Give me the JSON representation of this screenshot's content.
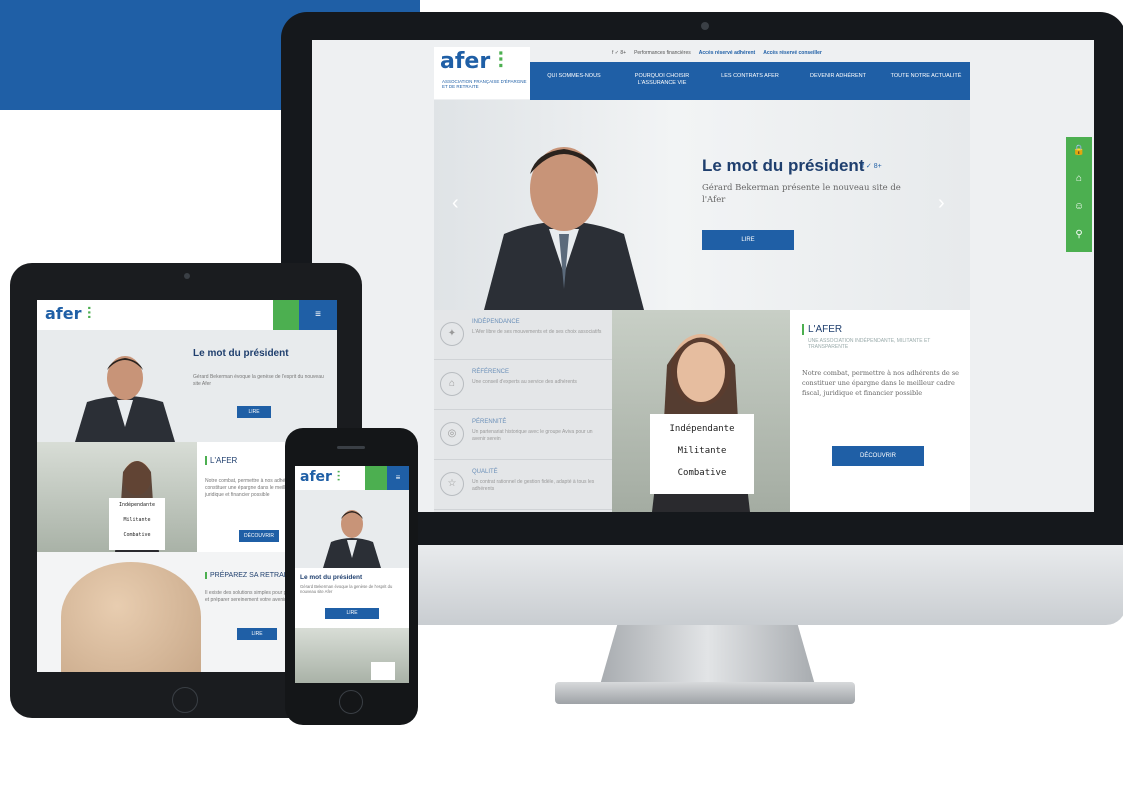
{
  "colors": {
    "brand_blue": "#1f5fa6",
    "brand_green": "#4caf50",
    "navy": "#1f3f6e"
  },
  "desktop": {
    "logo": {
      "word": "afer",
      "tagline": "ASSOCIATION FRANÇAISE D'ÉPARGNE ET DE RETRAITE"
    },
    "utility_bar": {
      "social_icons": "f  ✓  8+",
      "items": [
        "Performances financières",
        "Accès réservé adhérent",
        "Accès réservé conseiller"
      ]
    },
    "nav": [
      "QUI SOMMES-NOUS",
      "POURQUOI CHOISIR L'ASSURANCE VIE",
      "LES CONTRATS AFER",
      "DEVENIR ADHÉRENT",
      "TOUTE NOTRE ACTUALITÉ"
    ],
    "hero": {
      "title": "Le mot du président",
      "social": "f ✓ 8+",
      "text": "Gérard Bekerman présente le nouveau site de l'Afer",
      "button": "LIRE"
    },
    "features": [
      {
        "icon": "puzzle-icon",
        "title": "INDÉPENDANCE",
        "text": "L'Afer libre de ses mouvements et de ses choix associatifs"
      },
      {
        "icon": "building-icon",
        "title": "RÉFÉRENCE",
        "text": "Une conseil d'experts au service des adhérents"
      },
      {
        "icon": "shield-icon",
        "title": "PÉRENNITÉ",
        "text": "Un partenariat historique avec le groupe Aviva pour un avenir serein"
      },
      {
        "icon": "star-icon",
        "title": "QUALITÉ",
        "text": "Un contrat rationnel de gestion fidèle, adapté à tous les adhérents"
      }
    ],
    "sign_lines": [
      "Indépendante",
      "Militante",
      "Combative"
    ],
    "afer_box": {
      "title": "L'AFER",
      "subtitle": "UNE ASSOCIATION INDÉPENDANTE, MILITANTE ET TRANSPARENTE",
      "text": "Notre combat, permettre à nos adhérents de se constituer une épargne dans le meilleur cadre fiscal, juridique et financier possible",
      "button": "DÉCOUVRIR"
    },
    "side_tab": [
      "lock-icon",
      "bank-icon",
      "user-icon",
      "search-icon"
    ]
  },
  "tablet": {
    "hero_title": "Le mot du président",
    "hero_text": "Gérard Bekerman évoque la genèse de l'esprit du nouveau site Afer",
    "hero_button": "LIRE",
    "sign_lines": [
      "Indépendante",
      "Militante",
      "Combative"
    ],
    "afer_title": "L'AFER",
    "afer_text": "Notre combat, permettre à nos adhérents de se constituer une épargne dans le meilleur cadre fiscal, juridique et financier possible",
    "afer_button": "DÉCOUVRIR",
    "retirement_title": "PRÉPAREZ SA RETRAITE",
    "retirement_text": "Il existe des solutions simples pour protéger vos proches et préparer sereinement votre avenir",
    "retirement_button": "LIRE"
  },
  "phone": {
    "hero_title": "Le mot du président",
    "hero_text": "Gérard Bekerman évoque la genèse de l'esprit du nouveau site Afer",
    "button": "LIRE"
  }
}
